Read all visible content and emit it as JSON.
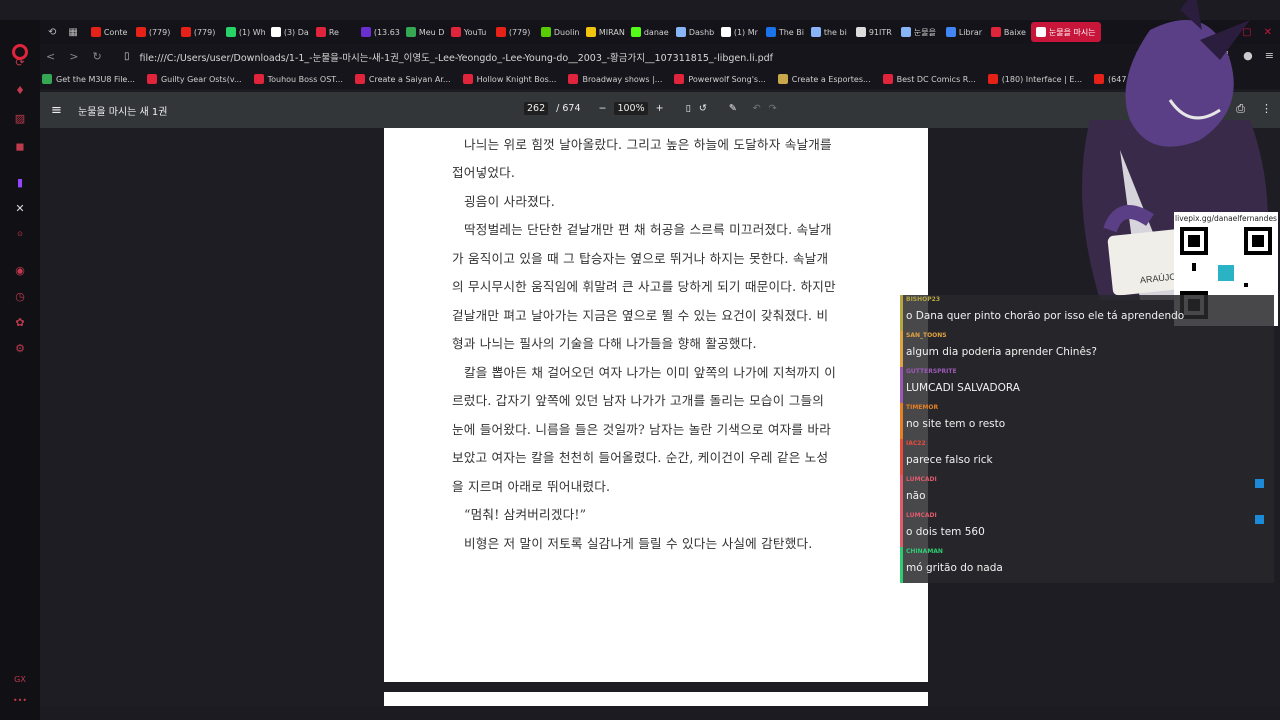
{
  "tabs": [
    {
      "label": "Conte",
      "color": "#e62117"
    },
    {
      "label": "(779)",
      "color": "#e62117"
    },
    {
      "label": "(779)",
      "color": "#e62117"
    },
    {
      "label": "(1) Wh",
      "color": "#25d366"
    },
    {
      "label": "(3) Da",
      "color": "#ffffff"
    },
    {
      "label": "Re",
      "color": "#e0243c"
    },
    {
      "label": "(13.63",
      "color": "#6a2fd0"
    },
    {
      "label": "Meu D",
      "color": "#34a853"
    },
    {
      "label": "YouTu",
      "color": "#e0243c"
    },
    {
      "label": "(779)",
      "color": "#e62117"
    },
    {
      "label": "Duolin",
      "color": "#58cc02"
    },
    {
      "label": "MIRAN",
      "color": "#f1c40f"
    },
    {
      "label": "danae",
      "color": "#53fc18"
    },
    {
      "label": "Dashb",
      "color": "#8ab4f8"
    },
    {
      "label": "(1) Mr",
      "color": "#ffffff"
    },
    {
      "label": "The Bi",
      "color": "#1a73e8"
    },
    {
      "label": "the bi",
      "color": "#8ab4f8"
    },
    {
      "label": "91ITR",
      "color": "#dddddd"
    },
    {
      "label": "눈물을",
      "color": "#8ab4f8"
    },
    {
      "label": "Librar",
      "color": "#4285f4"
    },
    {
      "label": "Baixe",
      "color": "#e0243c"
    },
    {
      "label": "눈물을 마시는",
      "color": "#ffffff",
      "active": true
    }
  ],
  "address": {
    "url": "file:///C:/Users/user/Downloads/1-1_-눈물을-마시는-새-1권_이영도_-Lee-Yeongdo_-Lee-Young-do__2003_-황금가지__107311815_-libgen.li.pdf"
  },
  "bookmarks": [
    {
      "label": "Get the M3U8 File...",
      "color": "#34a853"
    },
    {
      "label": "Guilty Gear Osts(v...",
      "color": "#e0243c"
    },
    {
      "label": "Touhou Boss OST...",
      "color": "#e0243c"
    },
    {
      "label": "Create a Saiyan Ar...",
      "color": "#e0243c"
    },
    {
      "label": "Hollow Knight Bos...",
      "color": "#e0243c"
    },
    {
      "label": "Broadway shows |...",
      "color": "#e0243c"
    },
    {
      "label": "Powerwolf Song's...",
      "color": "#e0243c"
    },
    {
      "label": "Create a Esportes...",
      "color": "#c8a84b"
    },
    {
      "label": "Best DC Comics R...",
      "color": "#e0243c"
    },
    {
      "label": "(180) Interface | E...",
      "color": "#e62117"
    },
    {
      "label": "(647",
      "color": "#e62117"
    }
  ],
  "pdf": {
    "title": "눈물을 마시는 새 1권",
    "page_current": "262",
    "page_total": "/ 674",
    "zoom": "100%"
  },
  "page_lines": [
    "나늬는 위로 힘껏 날아올랐다. 그리고 높은 하늘에 도달하자 속날개를",
    "접어넣었다.",
    "굉음이 사라졌다.",
    "딱정벌레는 단단한 겉날개만 편 채 허공을 스르륵 미끄러졌다. 속날개",
    "가 움직이고 있을 때 그 탑승자는 옆으로 뛰거나 하지는 못한다. 속날개",
    "의 무시무시한 움직임에 휘말려 큰 사고를 당하게 되기 때문이다. 하지만",
    "겉날개만 펴고 날아가는 지금은 옆으로 뛸 수 있는 요건이 갖춰졌다. 비",
    "형과 나늬는 필사의 기술을 다해 나가들을 향해 활공했다.",
    "칼을 뽑아든 채 걸어오던 여자 나가는 이미 앞쪽의 나가에 지척까지 이",
    "르렀다. 갑자기 앞쪽에 있던 남자 나가가 고개를 돌리는 모습이 그들의",
    "눈에 들어왔다. 니름을 들은 것일까? 남자는 놀란 기색으로 여자를 바라",
    "보았고 여자는 칼을 천천히 들어올렸다. 순간, 케이건이 우레 같은 노성",
    "을 지르며 아래로 뛰어내렸다.",
    "“멈춰! 삼켜버리겠다!”",
    "비형은 저 말이 저토록 실감나게 들릴 수 있다는 사실에 감탄했다."
  ],
  "overlay": {
    "qr_label": "livepix.gg/danaelfernandes"
  },
  "chat": [
    {
      "user": "BISHOP23",
      "text": "o Dana quer pinto chorão por isso ele tá aprendendo",
      "color": "#b5a642",
      "flag": false
    },
    {
      "user": "SAN_TOONS",
      "text": "algum dia poderia aprender Chinês?",
      "color": "#e0a340",
      "flag": false
    },
    {
      "user": "GUTTERSPRITE",
      "text": "LUMCADI SALVADORA",
      "color": "#9b59b6",
      "flag": false
    },
    {
      "user": "TIMEMOR",
      "text": "no site tem o resto",
      "color": "#e67e22",
      "flag": false
    },
    {
      "user": "IAC22",
      "text": "parece falso rick",
      "color": "#e74c3c",
      "flag": false
    },
    {
      "user": "LUMCADI",
      "text": "não",
      "color": "#e05a6d",
      "flag": true
    },
    {
      "user": "LUMCADI",
      "text": "o dois tem 560",
      "color": "#e05a6d",
      "flag": true
    },
    {
      "user": "CHINAMAN",
      "text": "mó gritão do nada",
      "color": "#2ecc71",
      "flag": false
    }
  ]
}
